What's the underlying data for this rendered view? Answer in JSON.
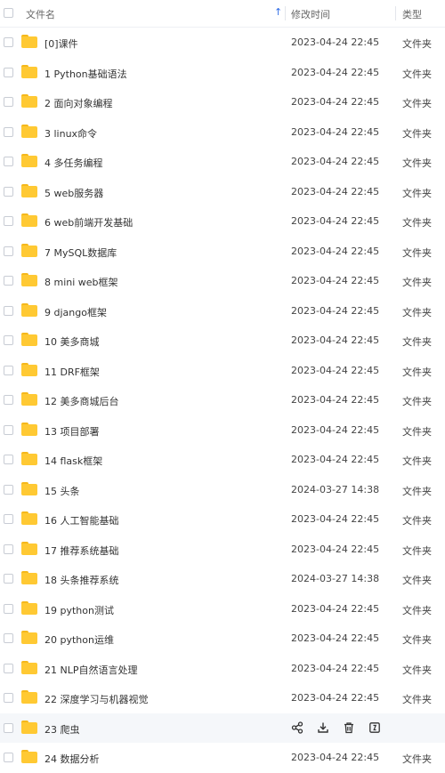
{
  "header": {
    "name": "文件名",
    "sort_icon": "↑",
    "time": "修改时间",
    "type": "类型"
  },
  "rows": [
    {
      "name": "[0]课件",
      "time": "2023-04-24 22:45",
      "type": "文件夹"
    },
    {
      "name": "1 Python基础语法",
      "time": "2023-04-24 22:45",
      "type": "文件夹"
    },
    {
      "name": "2 面向对象编程",
      "time": "2023-04-24 22:45",
      "type": "文件夹"
    },
    {
      "name": "3 linux命令",
      "time": "2023-04-24 22:45",
      "type": "文件夹"
    },
    {
      "name": "4 多任务编程",
      "time": "2023-04-24 22:45",
      "type": "文件夹"
    },
    {
      "name": "5 web服务器",
      "time": "2023-04-24 22:45",
      "type": "文件夹"
    },
    {
      "name": "6 web前端开发基础",
      "time": "2023-04-24 22:45",
      "type": "文件夹"
    },
    {
      "name": "7 MySQL数据库",
      "time": "2023-04-24 22:45",
      "type": "文件夹"
    },
    {
      "name": "8 mini web框架",
      "time": "2023-04-24 22:45",
      "type": "文件夹"
    },
    {
      "name": "9 django框架",
      "time": "2023-04-24 22:45",
      "type": "文件夹"
    },
    {
      "name": "10 美多商城",
      "time": "2023-04-24 22:45",
      "type": "文件夹"
    },
    {
      "name": "11 DRF框架",
      "time": "2023-04-24 22:45",
      "type": "文件夹"
    },
    {
      "name": "12 美多商城后台",
      "time": "2023-04-24 22:45",
      "type": "文件夹"
    },
    {
      "name": "13 项目部署",
      "time": "2023-04-24 22:45",
      "type": "文件夹"
    },
    {
      "name": "14 flask框架",
      "time": "2023-04-24 22:45",
      "type": "文件夹"
    },
    {
      "name": "15 头条",
      "time": "2024-03-27 14:38",
      "type": "文件夹"
    },
    {
      "name": "16 人工智能基础",
      "time": "2023-04-24 22:45",
      "type": "文件夹"
    },
    {
      "name": "17 推荐系统基础",
      "time": "2023-04-24 22:45",
      "type": "文件夹"
    },
    {
      "name": "18 头条推荐系统",
      "time": "2024-03-27 14:38",
      "type": "文件夹"
    },
    {
      "name": "19 python测试",
      "time": "2023-04-24 22:45",
      "type": "文件夹"
    },
    {
      "name": "20 python运维",
      "time": "2023-04-24 22:45",
      "type": "文件夹"
    },
    {
      "name": "21 NLP自然语言处理",
      "time": "2023-04-24 22:45",
      "type": "文件夹"
    },
    {
      "name": "22 深度学习与机器视觉",
      "time": "2023-04-24 22:45",
      "type": "文件夹"
    },
    {
      "name": "23 爬虫",
      "time": "",
      "type": "",
      "hover": true,
      "actions": [
        "share-icon",
        "download-icon",
        "delete-icon",
        "more-icon"
      ]
    },
    {
      "name": "24 数据分析",
      "time": "2023-04-24 22:45",
      "type": "文件夹"
    }
  ],
  "colors": {
    "folder": "#ffc933",
    "folder_tab": "#f5b81b",
    "accent": "#2e6be6",
    "hover_row": "#f5f7fa"
  }
}
